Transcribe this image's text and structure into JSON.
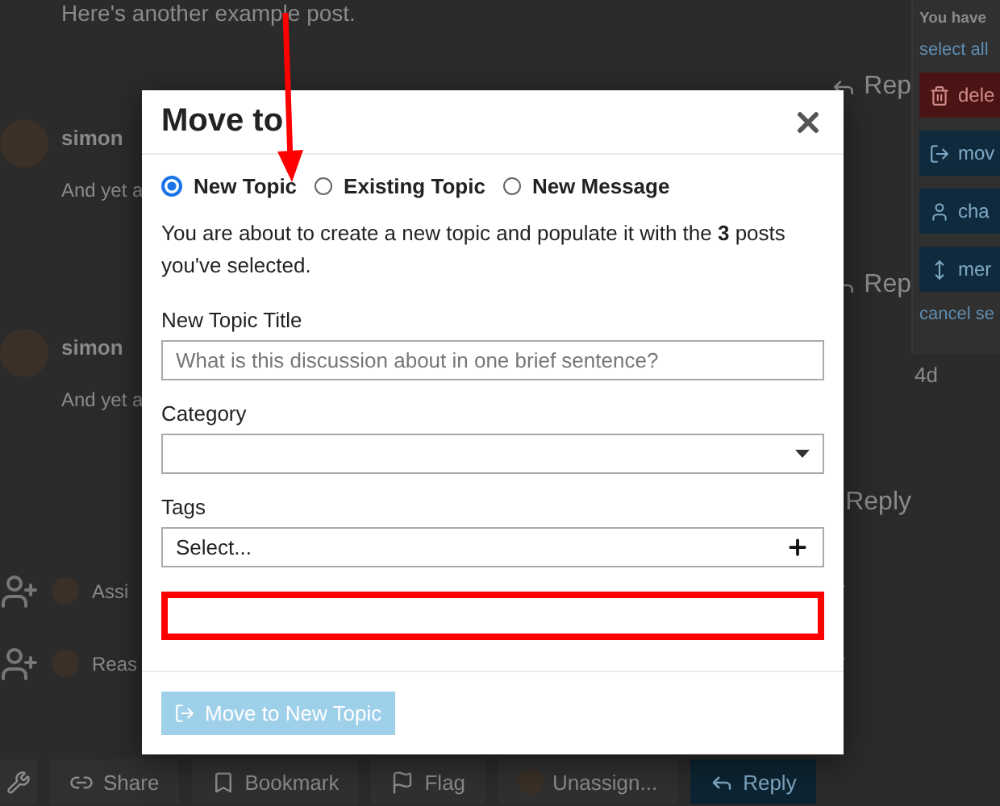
{
  "page": {
    "post_text": "Here's another example post.",
    "top_reply": "Rep",
    "posts": [
      {
        "author": "simon",
        "excerpt": "And yet a",
        "reply": "Rep"
      },
      {
        "author": "simon",
        "excerpt": "And yet a",
        "age": "4d",
        "reply": "Reply"
      }
    ],
    "small_actions": [
      {
        "text": "Assi"
      },
      {
        "text": "Reas"
      }
    ],
    "footer_buttons": [
      {
        "kind": "wrench"
      },
      {
        "kind": "share",
        "label": "Share"
      },
      {
        "kind": "bookmark",
        "label": "Bookmark"
      },
      {
        "kind": "flag",
        "label": "Flag"
      },
      {
        "kind": "unassign",
        "label": "Unassign..."
      },
      {
        "kind": "reply",
        "label": "Reply"
      }
    ]
  },
  "sidebar": {
    "notice": "You have",
    "select_all": "select all",
    "actions": [
      {
        "kind": "delete",
        "label": "dele"
      },
      {
        "kind": "move",
        "label": "mov"
      },
      {
        "kind": "owner",
        "label": "cha"
      },
      {
        "kind": "merge",
        "label": "mer"
      }
    ],
    "cancel": "cancel se"
  },
  "modal": {
    "title": "Move to",
    "options": [
      {
        "label": "New Topic",
        "selected": true
      },
      {
        "label": "Existing Topic",
        "selected": false
      },
      {
        "label": "New Message",
        "selected": false
      }
    ],
    "description": "You are about to create a new topic and populate it with the **3** posts you've selected.",
    "fields": [
      {
        "kind": "text",
        "label": "New Topic Title",
        "placeholder": "What is this discussion about in one brief sentence?"
      },
      {
        "kind": "dropdown",
        "label": "Category"
      },
      {
        "kind": "tags",
        "label": "Tags",
        "value": "Select..."
      }
    ],
    "submit": {
      "label": "Move to New Topic",
      "disabled": true
    }
  }
}
